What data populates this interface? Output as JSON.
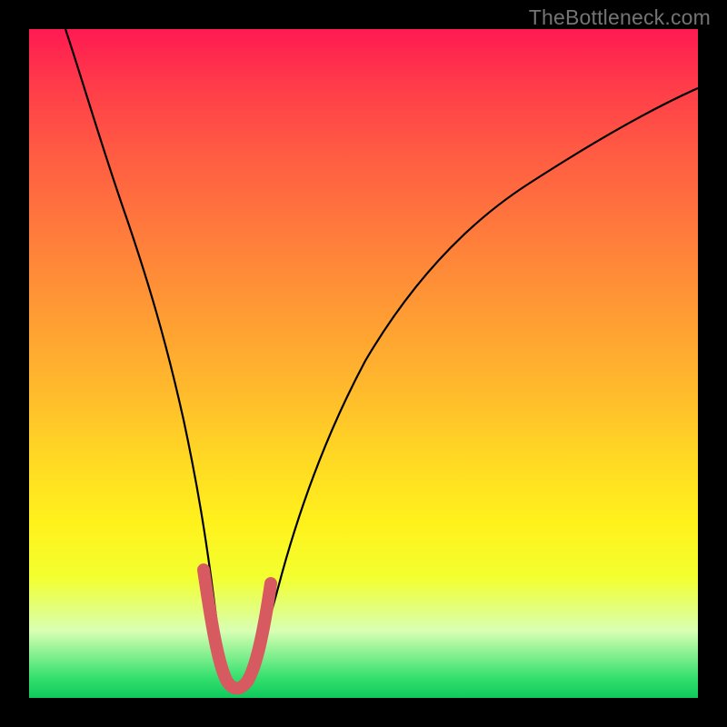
{
  "watermark": "TheBottleneck.com",
  "chart_data": {
    "type": "line",
    "title": "",
    "xlabel": "",
    "ylabel": "",
    "xlim": [
      0,
      100
    ],
    "ylim": [
      0,
      100
    ],
    "x": [
      0,
      4,
      8,
      12,
      16,
      20,
      23,
      25,
      27,
      29,
      31,
      33,
      36,
      40,
      46,
      52,
      58,
      66,
      76,
      88,
      100
    ],
    "values": [
      100,
      89,
      78,
      66,
      53,
      38,
      23,
      12,
      5,
      1,
      2,
      8,
      18,
      30,
      42,
      51,
      58,
      64,
      70,
      75,
      79
    ],
    "highlight_segment": {
      "x": [
        22,
        24,
        26,
        28,
        30,
        32,
        34
      ],
      "values": [
        17,
        10,
        5,
        2,
        3,
        8,
        15
      ],
      "color": "#d65a5f"
    },
    "gradient_bg": {
      "top": "#ff1a52",
      "bottom": "#0fc95c"
    }
  }
}
